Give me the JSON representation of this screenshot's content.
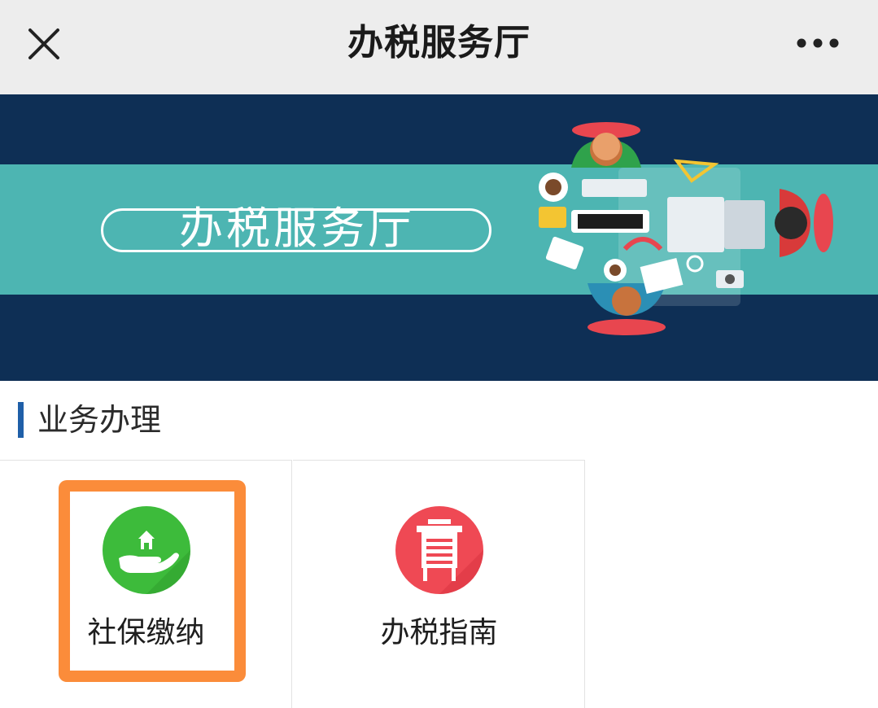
{
  "header": {
    "title": "办税服务厅",
    "close_icon": "close-icon",
    "more_icon": "more-icon",
    "background": "#ededed"
  },
  "banner": {
    "text": "办税服务厅",
    "colors": {
      "dark": "#0e2f55",
      "band": "#4db5b2"
    }
  },
  "section": {
    "title": "业务办理",
    "accent": "#1f5fa8"
  },
  "services": [
    {
      "label": "社保缴纳",
      "icon": "hand-house-icon",
      "color": "#3dbb3b",
      "highlighted": true
    },
    {
      "label": "办税指南",
      "icon": "guide-board-icon",
      "color": "#ef4954",
      "highlighted": false
    }
  ],
  "highlight_color": "#fb8c3a"
}
